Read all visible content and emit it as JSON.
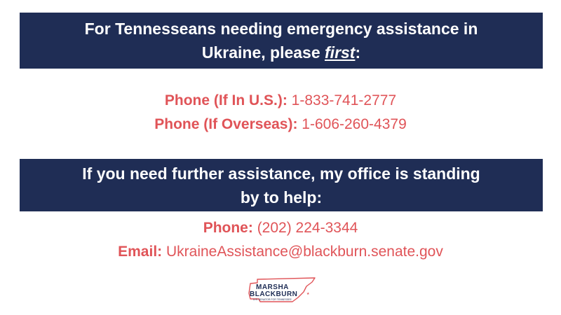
{
  "banner_top": {
    "line1": "For Tennesseans needing emergency assistance in",
    "line2_prefix": "Ukraine, please ",
    "line2_emphasis": "first",
    "line2_suffix": ":"
  },
  "phones_primary": [
    {
      "label": "Phone (If In U.S.):",
      "value": " 1-833-741-2777"
    },
    {
      "label": "Phone (If Overseas):",
      "value": " 1-606-260-4379"
    }
  ],
  "banner_bottom": {
    "line1": "If you need further assistance, my office is standing",
    "line2": "by to help:"
  },
  "office_contact": [
    {
      "label": "Phone:",
      "value": " (202) 224-3344"
    },
    {
      "label": "Email:",
      "value": " UkraineAssistance@blackburn.senate.gov"
    }
  ],
  "logo": {
    "line1": "MARSHA",
    "line2": "BLACKBURN",
    "tagline": "U.S. SENATOR FOR TENNESSEE"
  },
  "colors": {
    "navy": "#1f2d55",
    "red": "#e05458",
    "background": "#ffffff"
  }
}
